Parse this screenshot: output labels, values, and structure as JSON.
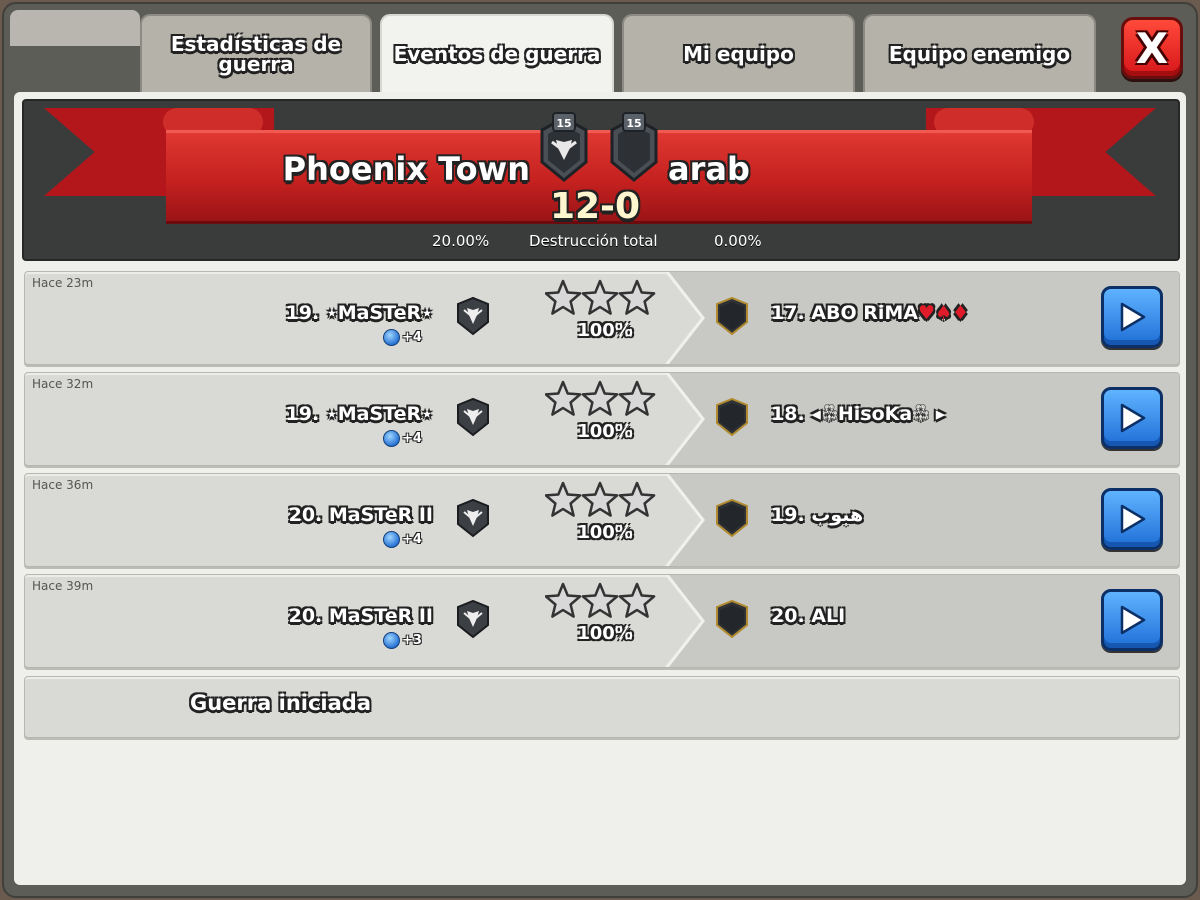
{
  "tabs": [
    {
      "label_line1": "Estadísticas de",
      "label_line2": "guerra",
      "active": false
    },
    {
      "label": "Eventos de guerra",
      "active": true
    },
    {
      "label": "Mi equipo",
      "active": false
    },
    {
      "label": "Equipo enemigo",
      "active": false
    }
  ],
  "close_label": "X",
  "header": {
    "my_clan": "Phoenix Town",
    "enemy_clan": "arab",
    "my_clan_level": "15",
    "enemy_clan_level": "15",
    "score": "12-0",
    "my_destruction": "20.00%",
    "destruction_label": "Destrucción total",
    "enemy_destruction": "0.00%"
  },
  "events": [
    {
      "time": "Hace 23m",
      "attacker": "19. ⋆MaSTeR⋆",
      "league_bonus": "+4",
      "stars": 3,
      "percent": "100%",
      "defender": "17. ABO RiMA",
      "defender_suffix": "♥♠♦"
    },
    {
      "time": "Hace 32m",
      "attacker": "19. ⋆MaSTeR⋆",
      "league_bonus": "+4",
      "stars": 3,
      "percent": "100%",
      "defender": "18. ◂♧HisoKa♧ ▸",
      "defender_suffix": ""
    },
    {
      "time": "Hace 36m",
      "attacker": "20. MaSTeR II",
      "league_bonus": "+4",
      "stars": 3,
      "percent": "100%",
      "defender": "19. هبوب",
      "defender_suffix": ""
    },
    {
      "time": "Hace 39m",
      "attacker": "20. MaSTeR II",
      "league_bonus": "+3",
      "stars": 3,
      "percent": "100%",
      "defender": "20. ALI",
      "defender_suffix": ""
    }
  ],
  "war_start_label": "Guerra iniciada",
  "colors": {
    "ribbon_red": "#c4211f",
    "replay_blue": "#1f6fd7",
    "close_red": "#d6161a"
  }
}
